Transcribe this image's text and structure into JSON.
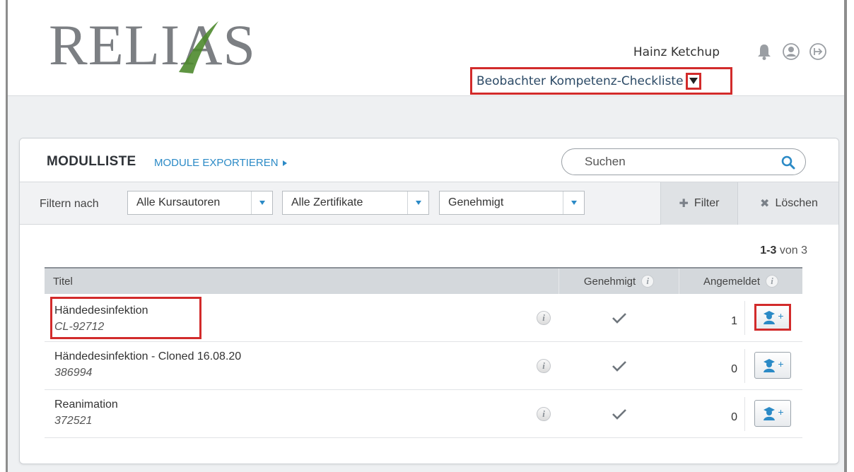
{
  "header": {
    "logo": "RELIAS",
    "user_name": "Hainz Ketchup",
    "role": "Beobachter Kompetenz-Checkliste"
  },
  "module_list": {
    "title": "MODULLISTE",
    "export_label": "MODULE EXPORTIEREN",
    "search_placeholder": "Suchen",
    "filter_label": "Filtern nach",
    "filters": [
      "Alle Kursautoren",
      "Alle Zertifikate",
      "Genehmigt"
    ],
    "filter_button": "Filter",
    "clear_button": "Löschen",
    "pager_range": "1-3",
    "pager_total": "von 3",
    "columns": {
      "title": "Titel",
      "approved": "Genehmigt",
      "registered": "Angemeldet"
    },
    "rows": [
      {
        "name": "Händedesinfektion",
        "code": "CL-92712",
        "registered": "1"
      },
      {
        "name": "Händedesinfektion - Cloned 16.08.20",
        "code": "386994",
        "registered": "0"
      },
      {
        "name": "Reanimation",
        "code": "372521",
        "registered": "0"
      }
    ]
  },
  "colors": {
    "accent": "#2b8ac6",
    "highlight": "#d22b2b",
    "logo_green": "#4e8a2e"
  }
}
